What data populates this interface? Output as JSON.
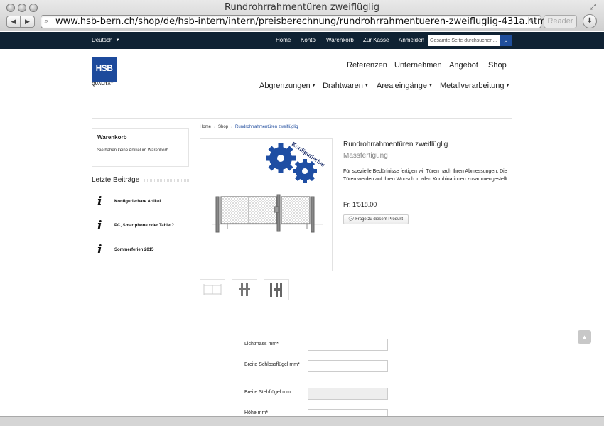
{
  "browser": {
    "window_title": "Rundrohrrahmentüren zweiflüglig",
    "url": "www.hsb-bern.ch/shop/de/hsb-intern/intern/preisberechnung/rundrohrrahmentueren-zweifluglig-431a.html",
    "reader_label": "Reader"
  },
  "topbar": {
    "language": "Deutsch",
    "links": [
      "Home",
      "Konto",
      "Warenkorb",
      "Zur Kasse",
      "Anmelden"
    ],
    "search_placeholder": "Gesamte Seite durchsuchen..."
  },
  "header": {
    "logo_text": "HSB",
    "logo_subtext": "QUALITÄT",
    "main_nav": [
      "Referenzen",
      "Unternehmen",
      "Angebot",
      "Shop"
    ],
    "sub_nav": [
      "Abgrenzungen",
      "Drahtwaren",
      "Arealeingänge",
      "Metallverarbeitung"
    ]
  },
  "sidebar": {
    "cart_title": "Warenkorb",
    "cart_text": "Sie haben keine Artikel im Warenkorb.",
    "posts_title": "Letzte Beiträge",
    "posts": [
      "Konfigurierbare Artikel",
      "PC, Smartphone oder Tablet?",
      "Sommerferien 2015"
    ]
  },
  "breadcrumb": [
    "Home",
    "Shop",
    "Rundrohrrahmentüren zweiflüglig"
  ],
  "product": {
    "badge_text": "Konfigurierbar",
    "title": "Rundrohrrahmentüren zweiflüglig",
    "subtitle": "Massfertigung",
    "description": "Für spezielle Bedürfnisse fertigen wir Türen nach Ihren Abmessungen. Die Türen werden auf Ihren Wunsch in allen Kombinationen zusammengestellt.",
    "price": "Fr. 1'518.00",
    "ask_button": "Frage zu diesem Produkt"
  },
  "form": {
    "fields": [
      {
        "label": "Lichtmass mm*",
        "value": ""
      },
      {
        "label": "Breite Schlossflügel mm*",
        "value": ""
      },
      {
        "label": "Breite Stehflügel mm",
        "value": ""
      },
      {
        "label": "Höhe mm*",
        "value": ""
      }
    ]
  },
  "icons": {
    "nav_back": "chevron-left-icon",
    "nav_forward": "chevron-right-icon",
    "search": "search-icon",
    "reload": "reload-icon",
    "download": "download-icon",
    "info": "info-icon",
    "comment": "comment-icon",
    "scroll_top": "chevron-up-icon"
  },
  "colors": {
    "topbar_bg": "#0f2233",
    "brand_blue": "#1d4a9c",
    "gear_blue": "#1f4ea3"
  }
}
